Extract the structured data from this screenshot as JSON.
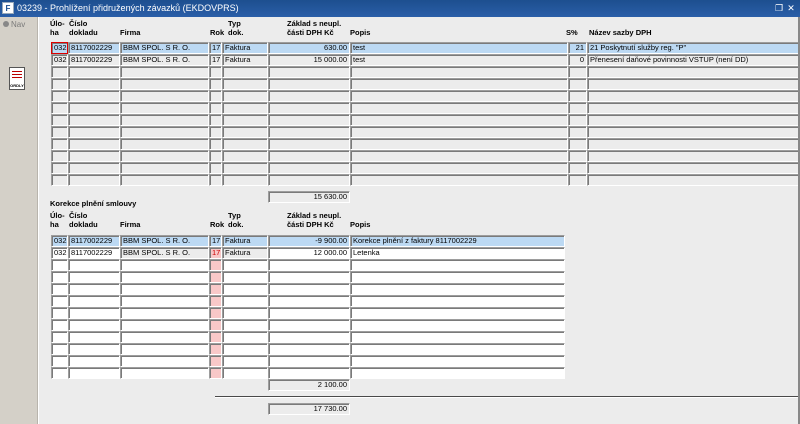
{
  "window": {
    "title": "03239 - Prohlížení přidružených závazků (EKDOVPRS)"
  },
  "sidebar": {
    "nav_label": "Nav",
    "tool_button_label": "ORDLY"
  },
  "table1": {
    "headers": {
      "uloha_top": "Úlo-",
      "uloha_bottom": "ha",
      "cislo_top": "Číslo",
      "cislo_bottom": "dokladu",
      "firma": "Firma",
      "rok": "Rok",
      "typ_top": "Typ",
      "typ_bottom": "dok.",
      "zaklad_top": "Základ s neupl.",
      "zaklad_bottom": "části DPH Kč",
      "popis": "Popis",
      "sazba": "S%",
      "nazev": "Název sazby DPH"
    },
    "rows": [
      {
        "uloha": "032",
        "cislo": "8117002229",
        "firma": "BBM SPOL. S R. O.",
        "rok": "17",
        "typ": "Faktura",
        "zaklad": "630.00",
        "popis": "test",
        "sazba": "21",
        "nazev": "21  Poskytnutí služby reg. \"P\""
      },
      {
        "uloha": "032",
        "cislo": "8117002229",
        "firma": "BBM SPOL. S R. O.",
        "rok": "17",
        "typ": "Faktura",
        "zaklad": "15 000.00",
        "popis": "test",
        "sazba": "0",
        "nazev": "Přenesení daňové povinnosti VSTUP (není DD)"
      }
    ],
    "total": "15 630.00"
  },
  "table2": {
    "section_title": "Korekce plnění smlouvy",
    "headers": {
      "uloha_top": "Úlo-",
      "uloha_bottom": "ha",
      "cislo_top": "Číslo",
      "cislo_bottom": "dokladu",
      "firma": "Firma",
      "rok": "Rok",
      "typ_top": "Typ",
      "typ_bottom": "dok.",
      "zaklad_top": "Základ s neupl.",
      "zaklad_bottom": "části DPH Kč",
      "popis": "Popis"
    },
    "rows": [
      {
        "uloha": "032",
        "cislo": "8117002229",
        "firma": "BBM SPOL. S R. O.",
        "rok": "17",
        "typ": "Faktura",
        "zaklad": "-9 900.00",
        "popis": "Korekce plnění z faktury 8117002229"
      },
      {
        "uloha": "032",
        "cislo": "8117002229",
        "firma": "BBM SPOL. S R. O.",
        "rok": "17",
        "typ": "Faktura",
        "zaklad": "12 000.00",
        "popis": "Letenka"
      }
    ],
    "total": "2 100.00"
  },
  "grand_total": "17 730.00"
}
